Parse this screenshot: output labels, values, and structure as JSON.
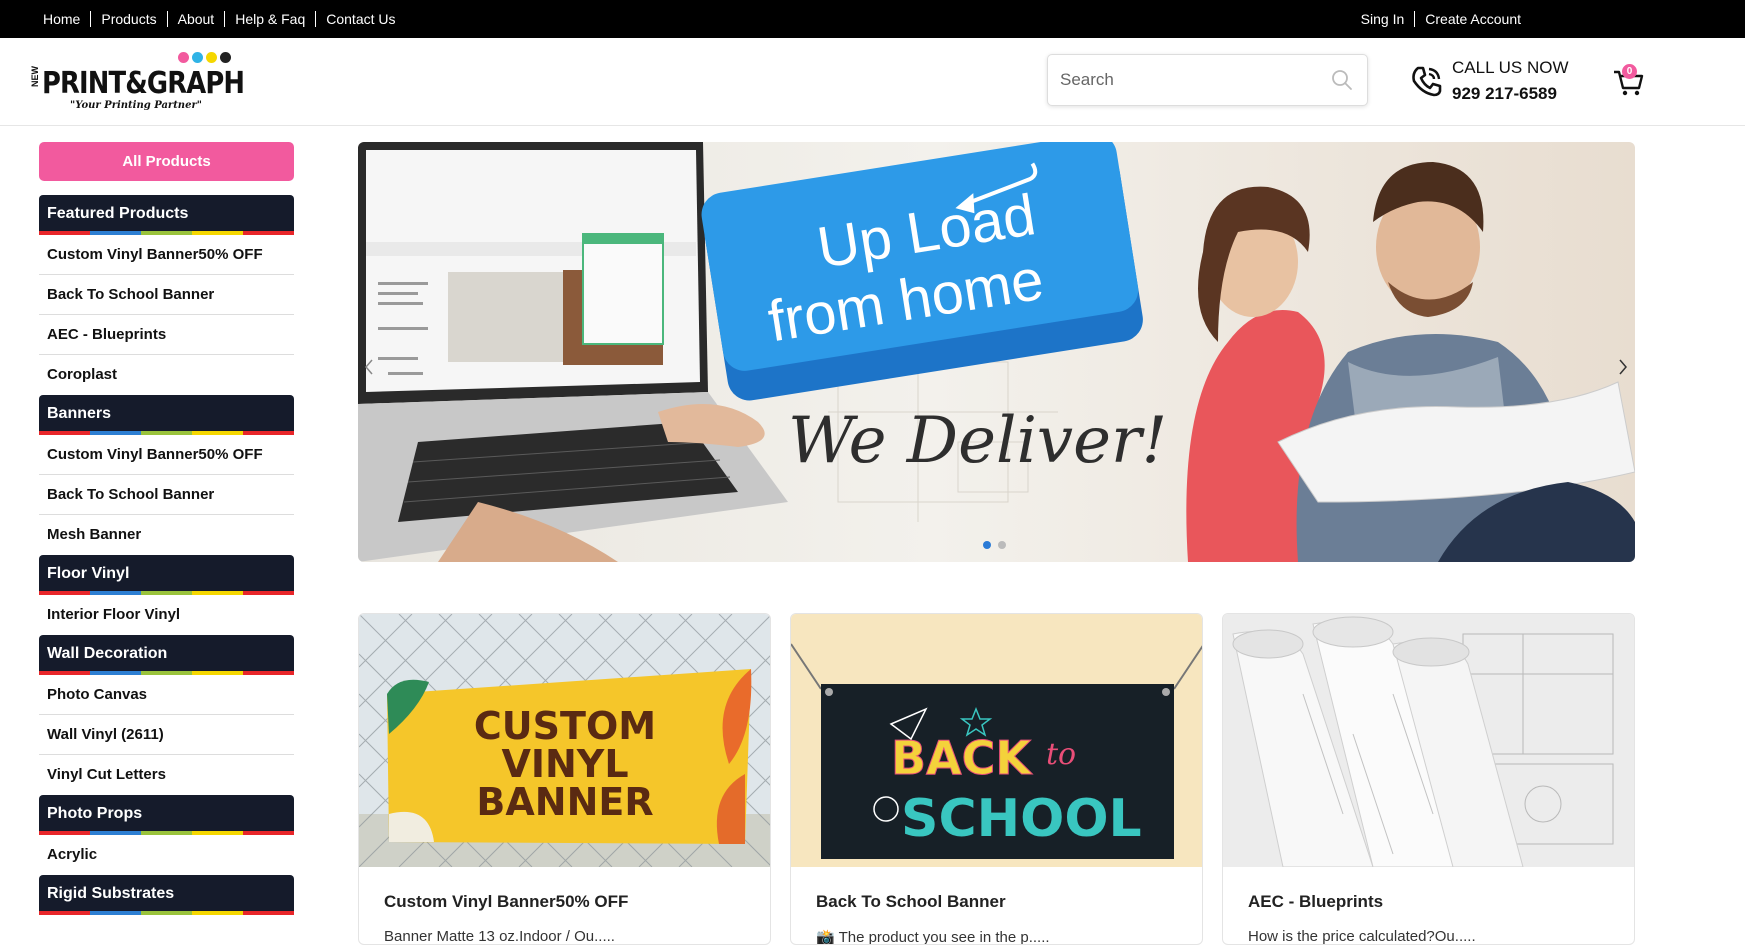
{
  "topnav": {
    "links": [
      "Home",
      "Products",
      "About",
      "Help & Faq",
      "Contact Us"
    ],
    "right": [
      "Sing In",
      "Create Account"
    ]
  },
  "logo": {
    "new": "NEW",
    "main": "PRINT&GRAPH",
    "tagline": "\"Your Printing Partner\"",
    "dot_colors": [
      "#f25a9e",
      "#2fb3e6",
      "#f5d700",
      "#222222"
    ]
  },
  "search": {
    "placeholder": "Search",
    "value": ""
  },
  "call": {
    "label": "CALL US NOW",
    "number": "929 217-6589"
  },
  "cart": {
    "count": "0"
  },
  "sidebar": {
    "all_products": "All Products",
    "stripe_colors": [
      "#e8262a",
      "#2d7fd3",
      "#9ac33c",
      "#f5d700",
      "#e8262a"
    ],
    "categories": [
      {
        "title": "Featured Products",
        "items": [
          "Custom Vinyl Banner50% OFF",
          "Back To School Banner",
          "AEC - Blueprints",
          "Coroplast"
        ]
      },
      {
        "title": "Banners",
        "items": [
          "Custom Vinyl Banner50% OFF",
          "Back To School Banner",
          "Mesh Banner"
        ]
      },
      {
        "title": "Floor Vinyl",
        "items": [
          "Interior Floor Vinyl"
        ]
      },
      {
        "title": "Wall Decoration",
        "items": [
          "Photo Canvas",
          "Wall Vinyl (2611)",
          "Vinyl Cut Letters"
        ]
      },
      {
        "title": "Photo Props",
        "items": [
          "Acrylic"
        ]
      },
      {
        "title": "Rigid Substrates",
        "items": []
      }
    ]
  },
  "banner": {
    "key_line1": "Up Load",
    "key_line2": "from home",
    "deliver": "We Deliver!",
    "slides": 2,
    "active_slide": 1
  },
  "products": [
    {
      "title": "Custom Vinyl Banner50% OFF",
      "desc": "Banner Matte 13 oz.Indoor / Ou.....",
      "image_text": [
        "CUSTOM",
        "VINYL",
        "BANNER"
      ]
    },
    {
      "title": "Back To School Banner",
      "desc": "📸 The product you see in the p.....",
      "image_text": [
        "BACK",
        "to",
        "SCHOOL"
      ]
    },
    {
      "title": "AEC - Blueprints",
      "desc": "How is the price calculated?Ou....."
    }
  ]
}
